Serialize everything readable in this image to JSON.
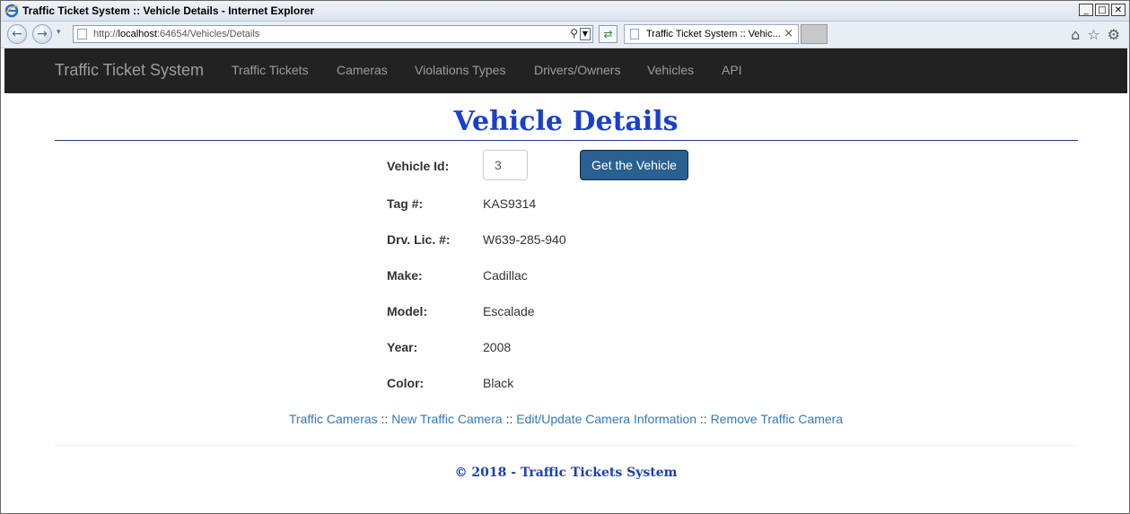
{
  "window": {
    "title": "Traffic Ticket System :: Vehicle Details - Internet Explorer",
    "controls": {
      "minimize": "_",
      "maximize": "□",
      "close": "✕"
    }
  },
  "browser": {
    "url_prefix": "http://",
    "url_host": "localhost",
    "url_rest": ":64654/Vehicles/Details",
    "tab_title": "Traffic Ticket System :: Vehic...",
    "icons": [
      "back-icon",
      "forward-icon",
      "search-icon",
      "refresh-icon",
      "home-icon",
      "favorites-star-icon",
      "settings-gear-icon"
    ]
  },
  "navbar": {
    "brand": "Traffic Ticket System",
    "links": [
      "Traffic Tickets",
      "Cameras",
      "Violations Types",
      "Drivers/Owners",
      "Vehicles",
      "API"
    ]
  },
  "page": {
    "title": "Vehicle Details"
  },
  "form": {
    "vehicle_id_label": "Vehicle Id:",
    "vehicle_id_value": "3",
    "button_label": "Get the Vehicle"
  },
  "details": [
    {
      "label": "Tag #:",
      "value": "KAS9314"
    },
    {
      "label": "Drv. Lic. #:",
      "value": "W639-285-940"
    },
    {
      "label": "Make:",
      "value": "Cadillac"
    },
    {
      "label": "Model:",
      "value": "Escalade"
    },
    {
      "label": "Year:",
      "value": "2008"
    },
    {
      "label": "Color:",
      "value": "Black"
    }
  ],
  "links": {
    "items": [
      "Traffic Cameras",
      "New Traffic Camera",
      "Edit/Update Camera Information",
      "Remove Traffic Camera"
    ],
    "separator": "::"
  },
  "footer": {
    "text": "© 2018 - Traffic Tickets System"
  },
  "colors": {
    "title": "#1a3fd0",
    "navbar_bg": "#222222",
    "button_bg": "#286090",
    "link": "#337ab7"
  }
}
